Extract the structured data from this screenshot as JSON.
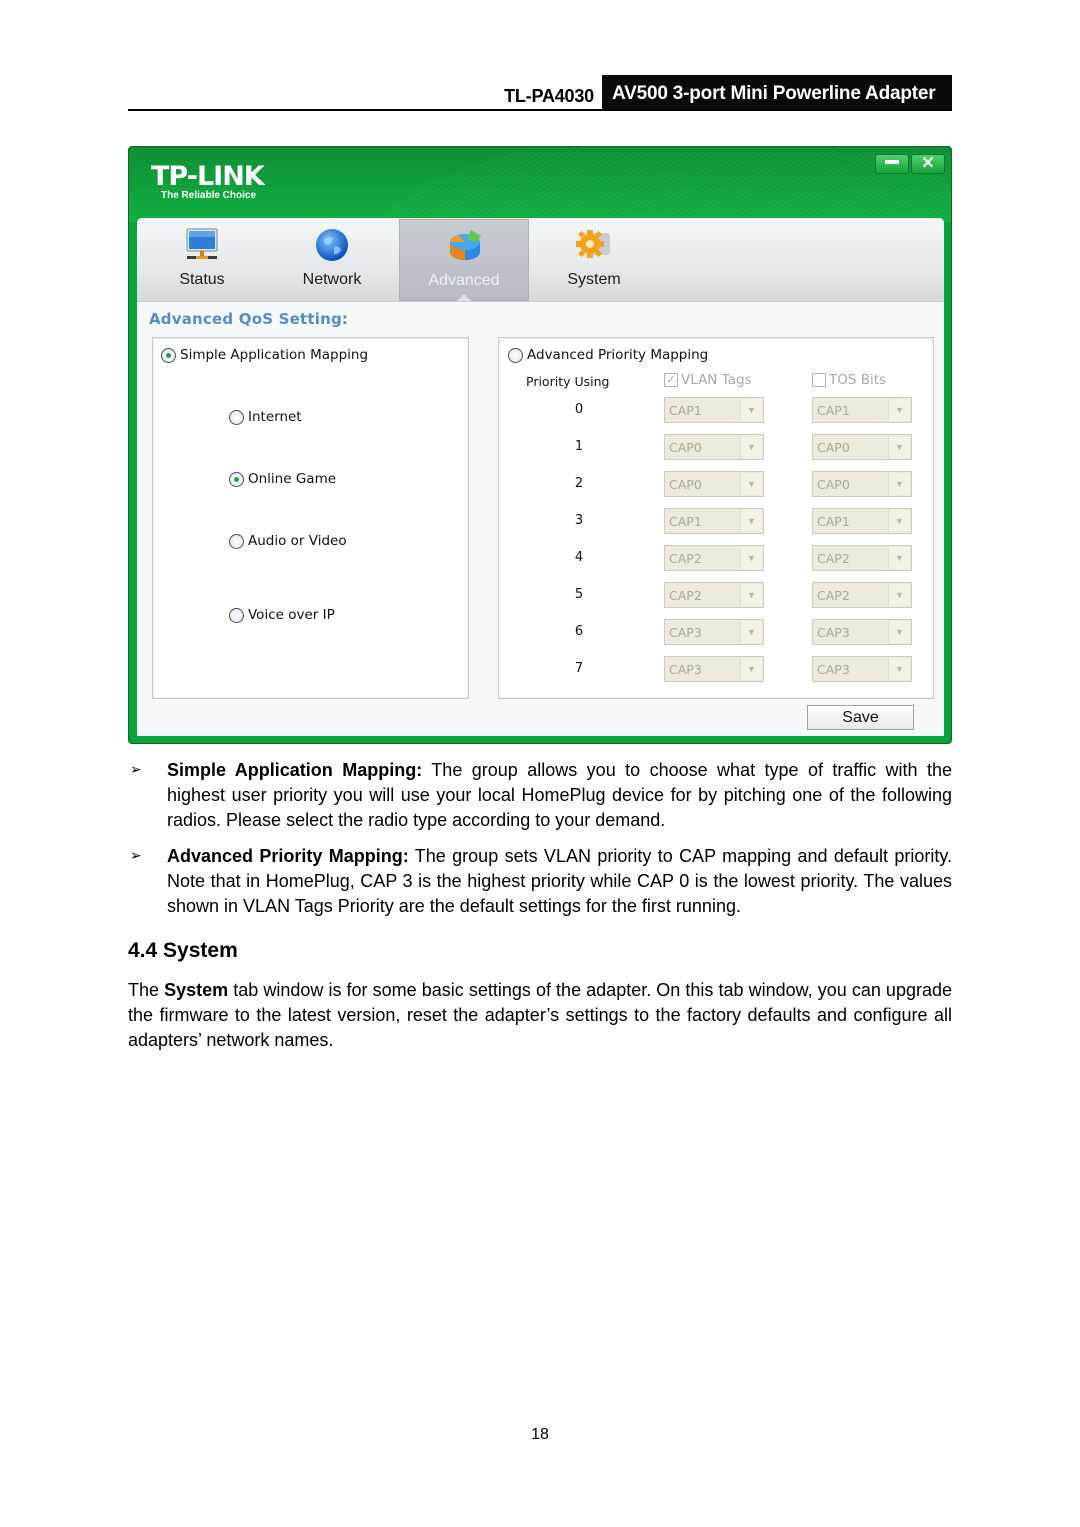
{
  "header": {
    "model": "TL-PA4030",
    "product": "AV500 3-port Mini Powerline Adapter"
  },
  "app": {
    "logo": {
      "brand": "TP-LINK",
      "tagline": "The Reliable Choice"
    },
    "window_buttons": {
      "minimize": "minimize",
      "close": "✕"
    },
    "tabs": [
      {
        "label": "Status",
        "icon": "monitor-icon",
        "active": false
      },
      {
        "label": "Network",
        "icon": "globe-icon",
        "active": false
      },
      {
        "label": "Advanced",
        "icon": "pie-chart-icon",
        "active": true
      },
      {
        "label": "System",
        "icon": "gear-icon",
        "active": false
      }
    ],
    "section_title": "Advanced QoS Setting:",
    "simple": {
      "label": "Simple Application Mapping",
      "selected": true,
      "options": [
        {
          "label": "Internet",
          "selected": false
        },
        {
          "label": "Online Game",
          "selected": true
        },
        {
          "label": "Audio or Video",
          "selected": false
        },
        {
          "label": "Voice over IP",
          "selected": false
        }
      ]
    },
    "advanced": {
      "label": "Advanced Priority Mapping",
      "selected": false,
      "priority_using_label": "Priority Using",
      "vlan_tags": {
        "label": "VLAN Tags",
        "checked": true
      },
      "tos_bits": {
        "label": "TOS Bits",
        "checked": false
      },
      "rows": [
        {
          "priority": "0",
          "vlan": "CAP1",
          "tos": "CAP1"
        },
        {
          "priority": "1",
          "vlan": "CAP0",
          "tos": "CAP0"
        },
        {
          "priority": "2",
          "vlan": "CAP0",
          "tos": "CAP0"
        },
        {
          "priority": "3",
          "vlan": "CAP1",
          "tos": "CAP1"
        },
        {
          "priority": "4",
          "vlan": "CAP2",
          "tos": "CAP2"
        },
        {
          "priority": "5",
          "vlan": "CAP2",
          "tos": "CAP2"
        },
        {
          "priority": "6",
          "vlan": "CAP3",
          "tos": "CAP3"
        },
        {
          "priority": "7",
          "vlan": "CAP3",
          "tos": "CAP3"
        }
      ]
    },
    "save_label": "Save"
  },
  "bullets": [
    {
      "term": "Simple Application Mapping:",
      "text": " The group allows you to choose what type of traffic with the highest user priority you will use your local HomePlug device for by pitching one of the following radios. Please select the radio type according to your demand."
    },
    {
      "term": "Advanced Priority Mapping:",
      "text": " The group sets VLAN priority to CAP mapping and default priority. Note that in HomePlug, CAP 3 is the highest priority while CAP 0 is the lowest priority. The values shown in VLAN Tags Priority are the default settings for the first running."
    }
  ],
  "bullet_mark": "➢",
  "section": {
    "heading": "4.4 System",
    "para_pre": "The ",
    "para_bold": "System",
    "para_post": " tab window is for some basic settings of the adapter. On this tab window, you can upgrade the firmware to the latest version, reset the adapter’s settings to the factory defaults and configure all adapters’ network names."
  },
  "page_number": "18"
}
